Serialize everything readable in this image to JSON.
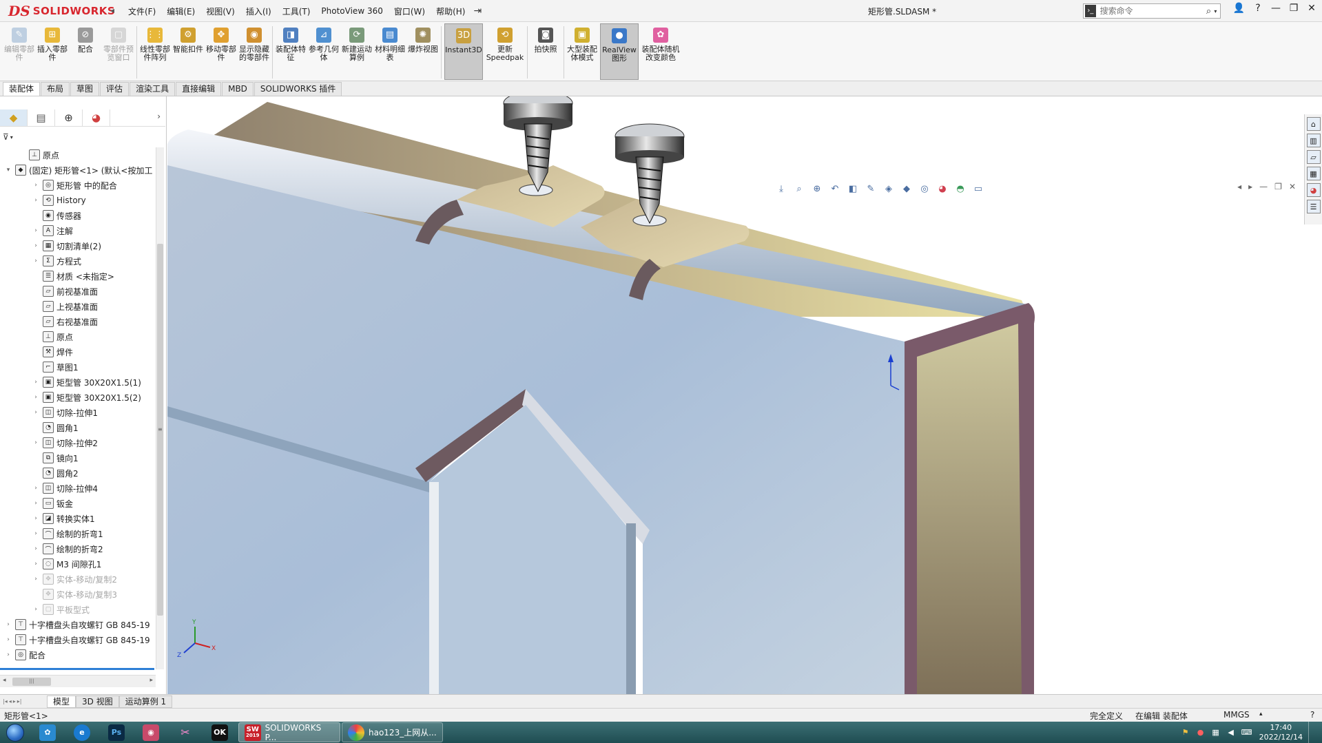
{
  "app": {
    "logo_ds": "DS",
    "logo_text": "SOLIDWORKS",
    "menu": [
      "文件(F)",
      "编辑(E)",
      "视图(V)",
      "插入(I)",
      "工具(T)",
      "PhotoView 360",
      "窗口(W)",
      "帮助(H)"
    ],
    "doc_title": "矩形管.SLDASM *",
    "search_placeholder": "搜索命令",
    "window_controls": [
      "?",
      "—",
      "❐",
      "✕"
    ]
  },
  "ribbon": {
    "buttons": [
      {
        "label": "编辑零部件",
        "state": "disabled",
        "icon": "edit-component-icon",
        "color": "#7aa0c8"
      },
      {
        "label": "插入零部件",
        "state": "normal",
        "icon": "insert-component-icon",
        "color": "#e8b83a"
      },
      {
        "label": "配合",
        "state": "normal",
        "icon": "mate-icon",
        "color": "#9a9a9a"
      },
      {
        "label": "零部件预览窗口",
        "state": "disabled",
        "icon": "component-preview-icon",
        "color": "#b0b0b0"
      },
      {
        "label": "线性零部件阵列",
        "state": "normal",
        "icon": "linear-pattern-icon",
        "color": "#e8b83a"
      },
      {
        "label": "智能扣件",
        "state": "normal",
        "icon": "smart-fastener-icon",
        "color": "#d0a030"
      },
      {
        "label": "移动零部件",
        "state": "normal",
        "icon": "move-component-icon",
        "color": "#e0a030"
      },
      {
        "label": "显示隐藏的零部件",
        "state": "normal",
        "icon": "show-hidden-icon",
        "color": "#d09030"
      },
      {
        "label": "装配体特征",
        "state": "normal",
        "icon": "assembly-feature-icon",
        "color": "#5080c0"
      },
      {
        "label": "参考几何体",
        "state": "normal",
        "icon": "reference-geometry-icon",
        "color": "#5090d0"
      },
      {
        "label": "新建运动算例",
        "state": "normal",
        "icon": "motion-study-icon",
        "color": "#7a9a7a"
      },
      {
        "label": "材料明细表",
        "state": "normal",
        "icon": "bom-icon",
        "color": "#4a8ad0"
      },
      {
        "label": "爆炸视图",
        "state": "normal",
        "icon": "exploded-view-icon",
        "color": "#a09060"
      },
      {
        "label": "Instant3D",
        "state": "active",
        "icon": "instant3d-icon",
        "color": "#c8a040"
      },
      {
        "label": "更新Speedpak",
        "state": "normal",
        "icon": "speedpak-icon",
        "color": "#d0a030"
      },
      {
        "label": "拍快照",
        "state": "normal",
        "icon": "snapshot-icon",
        "color": "#555555"
      },
      {
        "label": "大型装配体模式",
        "state": "normal",
        "icon": "large-assembly-icon",
        "color": "#d0b030"
      },
      {
        "label": "RealView图形",
        "state": "active",
        "icon": "realview-icon",
        "color": "#3a78c8"
      },
      {
        "label": "装配体随机改变颜色",
        "state": "normal",
        "icon": "random-color-icon",
        "color": "#e060a0"
      }
    ]
  },
  "cm_tabs": [
    "装配体",
    "布局",
    "草图",
    "评估",
    "渲染工具",
    "直接编辑",
    "MBD",
    "SOLIDWORKS 插件"
  ],
  "tree": {
    "items": [
      {
        "label": "原点",
        "indent": 1,
        "expand": "",
        "icon": "origin-icon",
        "dim": false
      },
      {
        "label": "(固定) 矩形管<1> (默认<按加工",
        "indent": 0,
        "expand": "▾",
        "icon": "part-icon",
        "dim": false
      },
      {
        "label": "矩形管 中的配合",
        "indent": 2,
        "expand": "›",
        "icon": "mates-icon",
        "dim": false
      },
      {
        "label": "History",
        "indent": 2,
        "expand": "›",
        "icon": "history-icon",
        "dim": false
      },
      {
        "label": "传感器",
        "indent": 2,
        "expand": "",
        "icon": "sensor-icon",
        "dim": false
      },
      {
        "label": "注解",
        "indent": 2,
        "expand": "›",
        "icon": "annotation-icon",
        "dim": false
      },
      {
        "label": "切割清单(2)",
        "indent": 2,
        "expand": "›",
        "icon": "cut-list-icon",
        "dim": false
      },
      {
        "label": "方程式",
        "indent": 2,
        "expand": "›",
        "icon": "equation-icon",
        "dim": false
      },
      {
        "label": "材质 <未指定>",
        "indent": 2,
        "expand": "",
        "icon": "material-icon",
        "dim": false
      },
      {
        "label": "前视基准面",
        "indent": 2,
        "expand": "",
        "icon": "plane-icon",
        "dim": false
      },
      {
        "label": "上视基准面",
        "indent": 2,
        "expand": "",
        "icon": "plane-icon",
        "dim": false
      },
      {
        "label": "右视基准面",
        "indent": 2,
        "expand": "",
        "icon": "plane-icon",
        "dim": false
      },
      {
        "label": "原点",
        "indent": 2,
        "expand": "",
        "icon": "origin-icon",
        "dim": false
      },
      {
        "label": "焊件",
        "indent": 2,
        "expand": "",
        "icon": "weldment-icon",
        "dim": false
      },
      {
        "label": "草图1",
        "indent": 2,
        "expand": "",
        "icon": "sketch-icon",
        "dim": false
      },
      {
        "label": "矩型管 30X20X1.5(1)",
        "indent": 2,
        "expand": "›",
        "icon": "structural-member-icon",
        "dim": false
      },
      {
        "label": "矩型管 30X20X1.5(2)",
        "indent": 2,
        "expand": "›",
        "icon": "structural-member-icon",
        "dim": false
      },
      {
        "label": "切除-拉伸1",
        "indent": 2,
        "expand": "›",
        "icon": "extruded-cut-icon",
        "dim": false
      },
      {
        "label": "圆角1",
        "indent": 2,
        "expand": "",
        "icon": "fillet-icon",
        "dim": false
      },
      {
        "label": "切除-拉伸2",
        "indent": 2,
        "expand": "›",
        "icon": "extruded-cut-icon",
        "dim": false
      },
      {
        "label": "镜向1",
        "indent": 2,
        "expand": "",
        "icon": "mirror-icon",
        "dim": false
      },
      {
        "label": "圆角2",
        "indent": 2,
        "expand": "",
        "icon": "fillet-icon",
        "dim": false
      },
      {
        "label": "切除-拉伸4",
        "indent": 2,
        "expand": "›",
        "icon": "extruded-cut-icon",
        "dim": false
      },
      {
        "label": "钣金",
        "indent": 2,
        "expand": "›",
        "icon": "sheet-metal-icon",
        "dim": false
      },
      {
        "label": "转换实体1",
        "indent": 2,
        "expand": "›",
        "icon": "convert-solid-icon",
        "dim": false
      },
      {
        "label": "绘制的折弯1",
        "indent": 2,
        "expand": "›",
        "icon": "sketched-bend-icon",
        "dim": false
      },
      {
        "label": "绘制的折弯2",
        "indent": 2,
        "expand": "›",
        "icon": "sketched-bend-icon",
        "dim": false
      },
      {
        "label": "M3 间隙孔1",
        "indent": 2,
        "expand": "›",
        "icon": "hole-wizard-icon",
        "dim": false
      },
      {
        "label": "实体-移动/复制2",
        "indent": 2,
        "expand": "›",
        "icon": "move-copy-icon",
        "dim": true
      },
      {
        "label": "实体-移动/复制3",
        "indent": 2,
        "expand": "",
        "icon": "move-copy-icon",
        "dim": true
      },
      {
        "label": "平板型式",
        "indent": 2,
        "expand": "›",
        "icon": "flat-pattern-icon",
        "dim": true
      },
      {
        "label": "十字槽盘头自攻螺钉 GB 845-19",
        "indent": 0,
        "expand": "›",
        "icon": "screw-icon",
        "dim": false
      },
      {
        "label": "十字槽盘头自攻螺钉 GB 845-19",
        "indent": 0,
        "expand": "›",
        "icon": "screw-icon",
        "dim": false
      },
      {
        "label": "配合",
        "indent": 0,
        "expand": "›",
        "icon": "mates-icon",
        "dim": false
      }
    ]
  },
  "model_tabs": [
    "模型",
    "3D 视图",
    "运动算例 1"
  ],
  "status": {
    "left": "矩形管<1>",
    "definition": "完全定义",
    "editing": "在编辑 装配体",
    "units": "MMGS",
    "units_arrow": "▴"
  },
  "taskbar": {
    "active_task": "SOLIDWORKS P...",
    "sw_badge": "2019",
    "browser_task": "hao123_上网从...",
    "time": "17:40",
    "date": "2022/12/14"
  },
  "colors": {
    "accent": "#2e7fd6",
    "brand": "#d8262e",
    "taskbar": "#2a5a60"
  }
}
